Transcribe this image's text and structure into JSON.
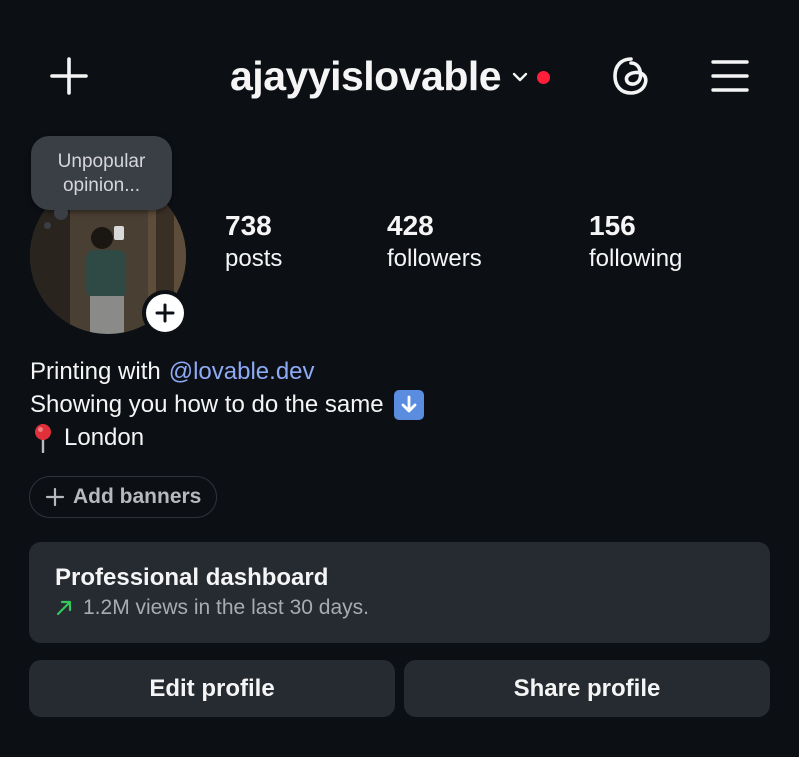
{
  "header": {
    "username": "ajayyislovable",
    "icons": {
      "new_post": "plus-icon",
      "account_switch": "chevron-down-icon",
      "notification": "red-dot",
      "threads": "threads-icon",
      "menu": "hamburger-menu-icon"
    }
  },
  "note": {
    "text": "Unpopular\nopinion..."
  },
  "stats": [
    {
      "value": "738",
      "label": "posts"
    },
    {
      "value": "428",
      "label": "followers"
    },
    {
      "value": "156",
      "label": "following"
    }
  ],
  "bio": {
    "line1_prefix": "Printing with",
    "line1_link": "@lovable.dev",
    "line2": "Showing you how to do the same",
    "line3": "London"
  },
  "add_banners": {
    "label": "Add banners"
  },
  "dashboard": {
    "title": "Professional dashboard",
    "subtitle": "1.2M views in the last 30 days."
  },
  "actions": {
    "edit": "Edit profile",
    "share": "Share profile"
  },
  "colors": {
    "background": "#0c0f14",
    "card": "#262a31",
    "link": "#8ea9f5",
    "notification_dot": "#ff1f3a",
    "trend_up": "#34c759"
  }
}
